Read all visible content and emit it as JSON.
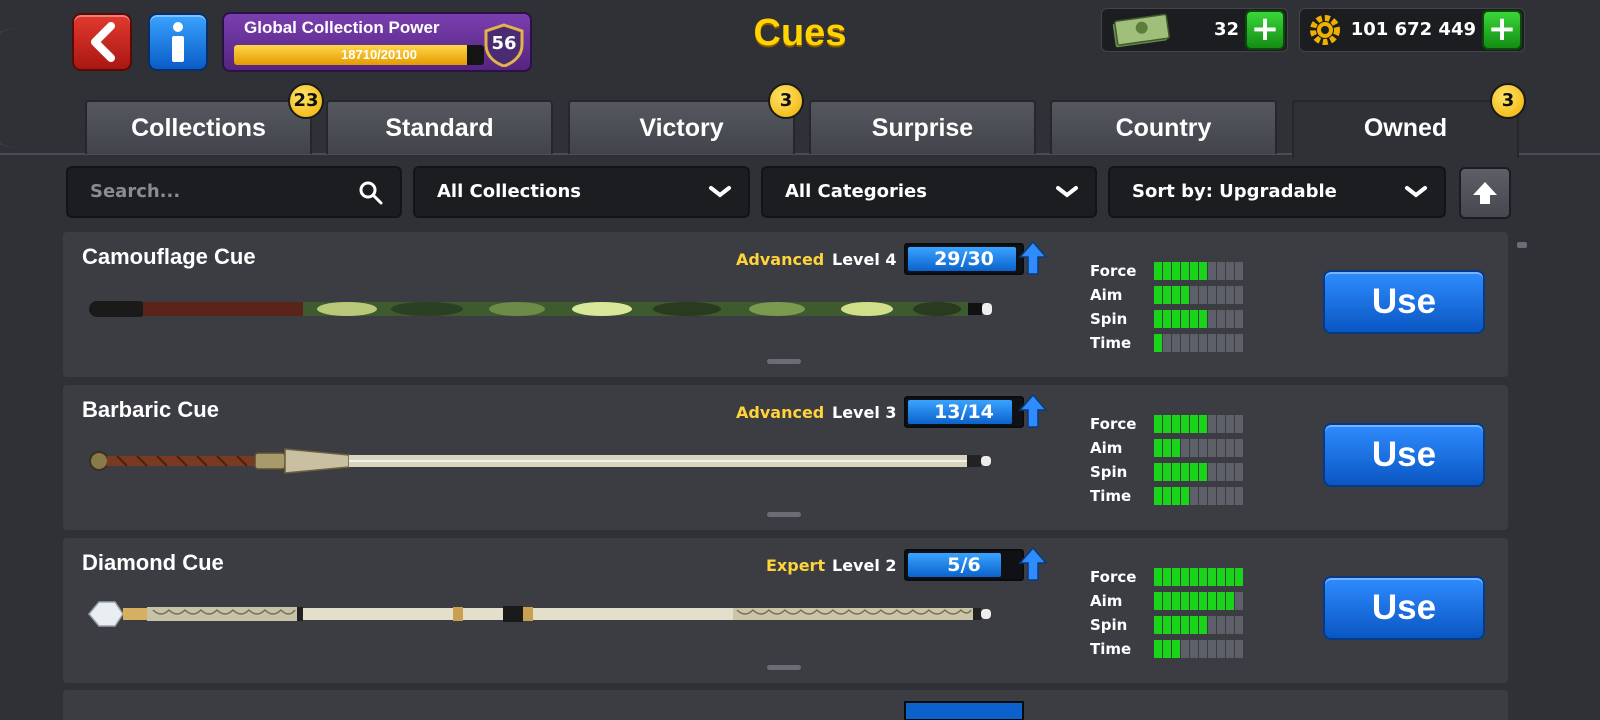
{
  "header": {
    "title": "Cues",
    "power": {
      "title": "Global Collection Power",
      "progress_text": "18710/20100",
      "fraction": 0.931,
      "level": "56"
    },
    "currency_cash": {
      "amount": "32",
      "plus": "+"
    },
    "currency_coins": {
      "amount": "101 672 449",
      "plus": "+"
    }
  },
  "tabs": [
    {
      "label": "Collections",
      "badge": "23"
    },
    {
      "label": "Standard",
      "badge": ""
    },
    {
      "label": "Victory",
      "badge": "3"
    },
    {
      "label": "Surprise",
      "badge": ""
    },
    {
      "label": "Country",
      "badge": ""
    },
    {
      "label": "Owned",
      "badge": "3",
      "active": true
    }
  ],
  "filters": {
    "search_placeholder": "Search...",
    "collections": "All Collections",
    "categories": "All Categories",
    "sort": "Sort by: Upgradable"
  },
  "stat_labels": {
    "force": "Force",
    "aim": "Aim",
    "spin": "Spin",
    "time": "Time"
  },
  "cues": [
    {
      "name": "Camouflage Cue",
      "tier": "Advanced",
      "level": "Level 4",
      "progress_text": "29/30",
      "progress": 0.967,
      "stats": {
        "force": 6,
        "aim": 4,
        "spin": 6,
        "time": 1
      },
      "button": "Use"
    },
    {
      "name": "Barbaric Cue",
      "tier": "Advanced",
      "level": "Level 3",
      "progress_text": "13/14",
      "progress": 0.929,
      "stats": {
        "force": 6,
        "aim": 3,
        "spin": 6,
        "time": 4
      },
      "button": "Use"
    },
    {
      "name": "Diamond Cue",
      "tier": "Expert",
      "level": "Level 2",
      "progress_text": "5/6",
      "progress": 0.833,
      "stats": {
        "force": 10,
        "aim": 9,
        "spin": 6,
        "time": 3
      },
      "button": "Use"
    }
  ],
  "colors": {
    "accent_yellow": "#ffd400",
    "button_blue": "#1a6fe0",
    "stat_green": "#19d419",
    "back_red": "#d0261c"
  },
  "icons": {
    "back": "back-arrow-icon",
    "info": "info-icon",
    "search": "search-icon",
    "chevron": "chevron-down-icon",
    "sort": "sort-up-arrow-icon",
    "cash": "cash-icon",
    "coins": "coin-gear-icon",
    "upgrade": "upgrade-arrow-icon"
  }
}
